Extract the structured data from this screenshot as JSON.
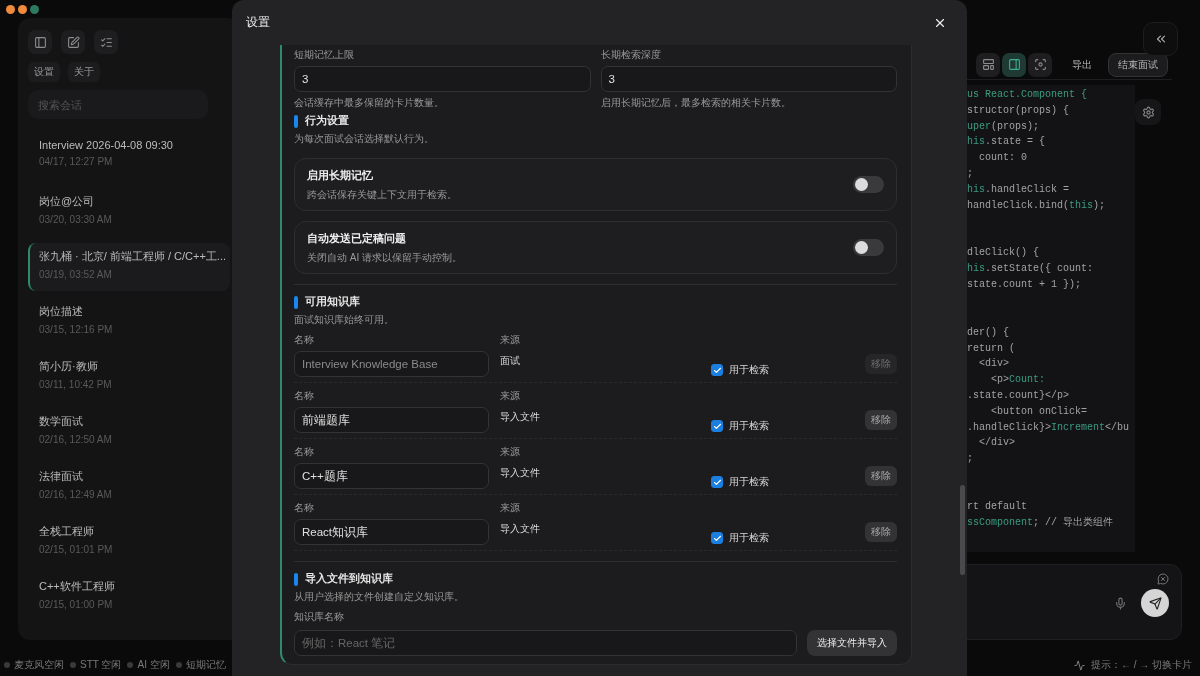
{
  "sidebar": {
    "buttons": [
      "设置",
      "关于"
    ],
    "search": {
      "placeholder": "搜索会话"
    },
    "sessions": [
      {
        "title": "Interview 2026-04-08 09:30",
        "time": "04/17, 12:27 PM",
        "selected": false
      },
      {
        "title": "岗位@公司",
        "time": "03/20, 03:30 AM",
        "selected": false
      },
      {
        "title": "张九桶 · 北京/ 前端工程师 / C/C++工...",
        "time": "03/19, 03:52 AM",
        "selected": true
      },
      {
        "title": "岗位描述",
        "time": "03/15, 12:16 PM",
        "selected": false
      },
      {
        "title": "简小历·教师",
        "time": "03/11, 10:42 PM",
        "selected": false
      },
      {
        "title": "数学面试",
        "time": "02/16, 12:50 AM",
        "selected": false
      },
      {
        "title": "法律面试",
        "time": "02/16, 12:49 AM",
        "selected": false
      },
      {
        "title": "全栈工程师",
        "time": "02/15, 01:01 PM",
        "selected": false
      },
      {
        "title": "C++软件工程师",
        "time": "02/15, 01:00 PM",
        "selected": false
      }
    ]
  },
  "workspace": {
    "view_buttons": [
      {
        "kind": "layout",
        "selected": false
      },
      {
        "kind": "panel",
        "selected": true
      },
      {
        "kind": "focus",
        "selected": false
      }
    ],
    "buttons": [
      {
        "label": "导出",
        "kind": "plain"
      },
      {
        "label": "结束面试",
        "kind": "outlined"
      }
    ],
    "code_blocks": [
      [
        [
          {
            "text": "us React.Component {",
            "kind": "keyword"
          }
        ],
        [
          {
            "text": "structor(props) {",
            "kind": "plain"
          }
        ],
        [
          {
            "text": "uper",
            "kind": "keyword"
          },
          {
            "text": "(props);",
            "kind": "plain"
          }
        ],
        [
          {
            "text": "his",
            "kind": "keyword"
          },
          {
            "text": ".state = {",
            "kind": "plain"
          }
        ],
        [
          {
            "text": "  count: 0",
            "kind": "plain"
          }
        ],
        [
          {
            "text": ";",
            "kind": "plain"
          }
        ],
        [
          {
            "text": "his",
            "kind": "keyword"
          },
          {
            "text": ".handleClick =",
            "kind": "plain"
          }
        ],
        [
          {
            "text": "handleClick.bind(",
            "kind": "plain"
          },
          {
            "text": "this",
            "kind": "keyword"
          },
          {
            "text": ");",
            "kind": "plain"
          }
        ]
      ],
      [
        [
          {
            "text": "dleClick() {",
            "kind": "plain"
          }
        ],
        [
          {
            "text": "his",
            "kind": "keyword"
          },
          {
            "text": ".setState({ count:",
            "kind": "plain"
          }
        ],
        [
          {
            "text": "state.count + 1 });",
            "kind": "plain"
          }
        ]
      ],
      [
        [
          {
            "text": "der() {",
            "kind": "plain"
          }
        ],
        [
          {
            "text": "return (",
            "kind": "plain"
          }
        ],
        [
          {
            "text": "  <div>",
            "kind": "plain"
          }
        ],
        [
          {
            "text": "    <p>",
            "kind": "plain"
          },
          {
            "text": "Count:",
            "kind": "keyword"
          }
        ],
        [
          {
            "text": ".state.count}</p>",
            "kind": "plain"
          }
        ],
        [
          {
            "text": "    <button onClick=",
            "kind": "plain"
          }
        ],
        [
          {
            "text": ".handleClick}>",
            "kind": "plain"
          },
          {
            "text": "Increment",
            "kind": "keyword"
          },
          {
            "text": "</bu",
            "kind": "plain"
          }
        ],
        [
          {
            "text": "  </div>",
            "kind": "plain"
          }
        ],
        [
          {
            "text": ";",
            "kind": "plain"
          }
        ]
      ],
      [
        [
          {
            "text": "rt default",
            "kind": "plain"
          }
        ],
        [
          {
            "text": "ssComponent",
            "kind": "keyword"
          },
          {
            "text": "; // 导出类组件",
            "kind": "plain"
          }
        ]
      ]
    ]
  },
  "status_bar": {
    "items": [
      "麦克风空闲",
      "STT 空闲",
      "AI 空闲",
      "短期记忆"
    ],
    "hint": "提示：← / → 切换卡片"
  },
  "dialog": {
    "title": "设置",
    "fields": [
      {
        "label": "短期记忆上限",
        "value": "3",
        "hint": "会话缓存中最多保留的卡片数量。"
      },
      {
        "label": "长期检索深度",
        "value": "3",
        "hint": "启用长期记忆后，最多检索的相关卡片数。"
      }
    ],
    "behavior": {
      "title": "行为设置",
      "description": "为每次面试会话选择默认行为。",
      "toggles": [
        {
          "title": "启用长期记忆",
          "description": "跨会话保存关键上下文用于检索。",
          "on": false
        },
        {
          "title": "自动发送已定稿问题",
          "description": "关闭自动 AI 请求以保留手动控制。",
          "on": false
        }
      ]
    },
    "knowledge": {
      "title": "可用知识库",
      "description": "面试知识库始终可用。",
      "rows": [
        {
          "name_label": "名称",
          "name": "Interview Knowledge Base",
          "source_label": "来源",
          "source": "面试",
          "checked": true,
          "check_label": "用于检索",
          "remove": "移除",
          "disabled": true
        },
        {
          "name_label": "名称",
          "name": "前端题库",
          "source_label": "来源",
          "source": "导入文件",
          "checked": true,
          "check_label": "用于检索",
          "remove": "移除",
          "disabled": false
        },
        {
          "name_label": "名称",
          "name": "C++题库",
          "source_label": "来源",
          "source": "导入文件",
          "checked": true,
          "check_label": "用于检索",
          "remove": "移除",
          "disabled": false
        },
        {
          "name_label": "名称",
          "name": "React知识库",
          "source_label": "来源",
          "source": "导入文件",
          "checked": true,
          "check_label": "用于检索",
          "remove": "移除",
          "disabled": false
        }
      ]
    },
    "import": {
      "title": "导入文件到知识库",
      "description": "从用户选择的文件创建自定义知识库。",
      "label": "知识库名称",
      "placeholder": "例如：React 笔记",
      "button": "选择文件并导入"
    }
  }
}
